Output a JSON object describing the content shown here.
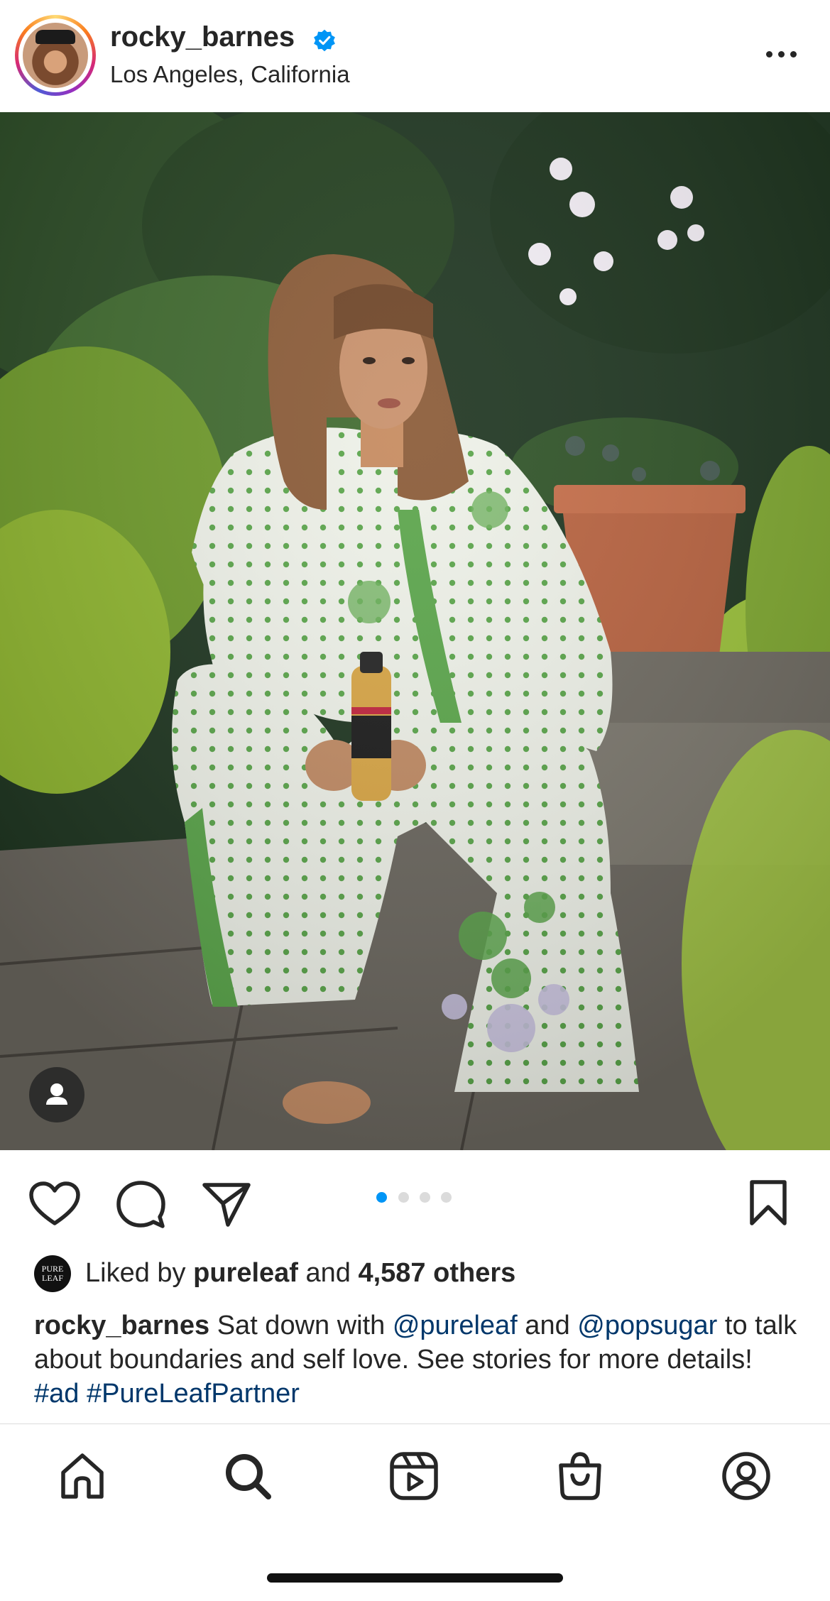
{
  "header": {
    "username": "rocky_barnes",
    "location": "Los Angeles, California",
    "verified": true
  },
  "post": {
    "carousel": {
      "count": 4,
      "active_index": 0,
      "active_color": "#0095f6"
    }
  },
  "likes": {
    "avatar_text": "PURE LEAF",
    "prefix": "Liked by",
    "user": "pureleaf",
    "conjunction": "and",
    "others": "4,587 others"
  },
  "caption": {
    "username": "rocky_barnes",
    "text1": " Sat down with ",
    "mention1": "@pureleaf",
    "text2": " and ",
    "mention2": "@popsugar",
    "text3": " to talk about boundaries and self love. See stories for more details! ",
    "hashtag1": "#ad",
    "text4": " ",
    "hashtag2": "#PureLeafPartner"
  },
  "tabbar": {
    "items": [
      "home",
      "search",
      "reels",
      "shop",
      "profile"
    ]
  }
}
